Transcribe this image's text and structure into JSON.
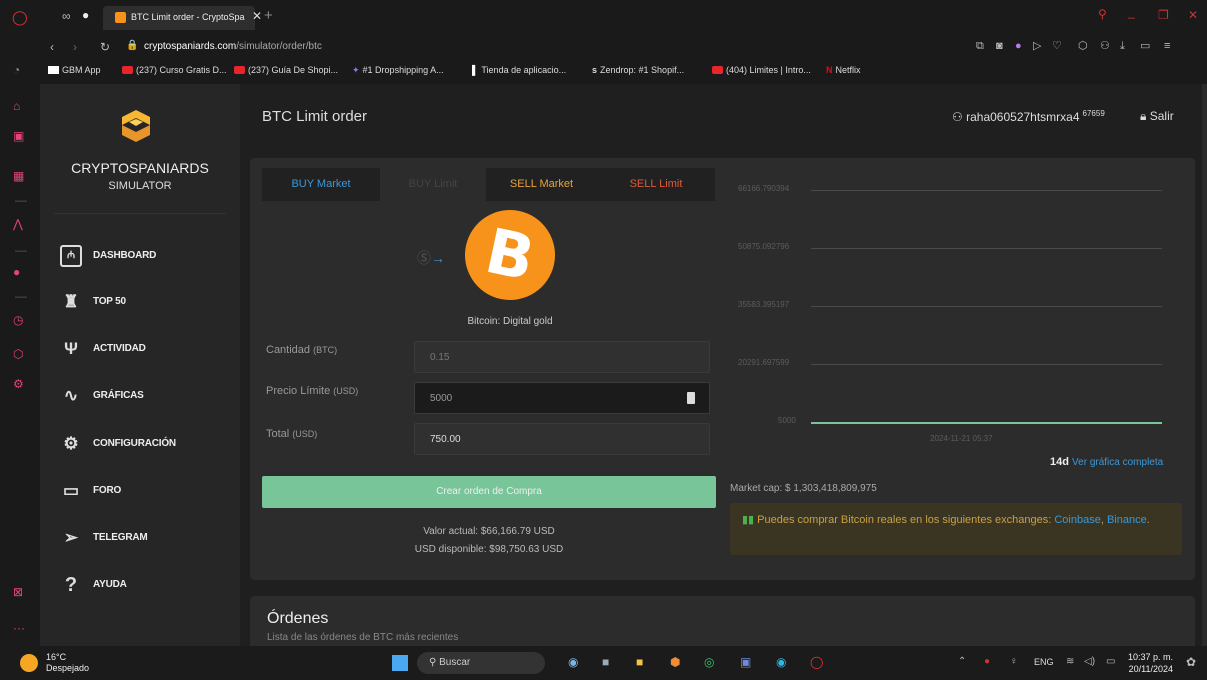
{
  "browser": {
    "tab_title": "BTC Limit order - CryptoSpa",
    "url_domain": "cryptospaniards.com",
    "url_path": "/simulator/order/btc",
    "bookmarks": [
      "GBM App",
      "(237) Curso Gratis D...",
      "(237) Guía De Shopi...",
      "#1 Dropshipping A...",
      "Tienda de aplicacio...",
      "Zendrop: #1 Shopif...",
      "(404) Limites | Intro...",
      "Netflix"
    ]
  },
  "sidebar": {
    "brand_name": "CRYPTOSPANIARDS",
    "brand_sub": "SIMULATOR",
    "items": [
      {
        "label": "DASHBOARD",
        "icon": "chart-bars-icon"
      },
      {
        "label": "TOP 50",
        "icon": "trophy-icon"
      },
      {
        "label": "ACTIVIDAD",
        "icon": "broadcast-icon"
      },
      {
        "label": "GRÁFICAS",
        "icon": "pulse-icon"
      },
      {
        "label": "CONFIGURACIÓN",
        "icon": "gear-icon"
      },
      {
        "label": "FORO",
        "icon": "message-icon"
      },
      {
        "label": "TELEGRAM",
        "icon": "telegram-icon"
      },
      {
        "label": "AYUDA",
        "icon": "question-icon"
      }
    ]
  },
  "header": {
    "title": "BTC Limit order",
    "username": "raha060527htsmrxa4",
    "user_rank": "67659",
    "logout": "Salir"
  },
  "order": {
    "tabs": [
      "BUY Market",
      "BUY Limit",
      "SELL Market",
      "SELL Limit"
    ],
    "coin_caption": "Bitcoin: Digital gold",
    "amount_label": "Cantidad",
    "amount_unit": "(BTC)",
    "amount_placeholder": "0.15",
    "price_label": "Precio Límite",
    "price_unit": "(USD)",
    "price_value": "5000",
    "total_label": "Total",
    "total_unit": "(USD)",
    "total_value": "750.00",
    "submit": "Crear orden de Compra",
    "current_value": "Valor actual: $66,166.79 USD",
    "available": "USD disponible: $98,750.63 USD"
  },
  "chart": {
    "y_ticks": [
      "66166.790394",
      "50875.092796",
      "35583.395197",
      "20291.697599",
      "5000"
    ],
    "x_tick": "2024-11-21 05:37",
    "range": "14d",
    "full_link": "Ver gráfica completa",
    "market_cap": "Market cap: $ 1,303,418,809,975",
    "exchange_note": "Puedes comprar Bitcoin reales en los siguientes exchanges:",
    "exchange_1": "Coinbase",
    "exchange_2": "Binance",
    "chart_data": {
      "type": "line",
      "yticks": [
        66166.790394,
        50875.092796,
        35583.395197,
        20291.697599,
        5000
      ],
      "x": [
        "2024-11-21 05:37"
      ],
      "series": [
        {
          "values": [
            5000
          ]
        }
      ]
    }
  },
  "orders": {
    "title": "Órdenes",
    "subtitle": "Lista de las órdenes de BTC más recientes"
  },
  "taskbar": {
    "temp": "16°C",
    "weather": "Despejado",
    "search": "Buscar",
    "lang": "ENG",
    "time": "10:37 p. m.",
    "date": "20/11/2024"
  },
  "colors": {
    "accent_green": "#79c59a",
    "buy_blue": "#3c98d8",
    "sell_orange": "#e8a33d",
    "sell_red": "#e25a38",
    "bitcoin": "#f7931a"
  }
}
